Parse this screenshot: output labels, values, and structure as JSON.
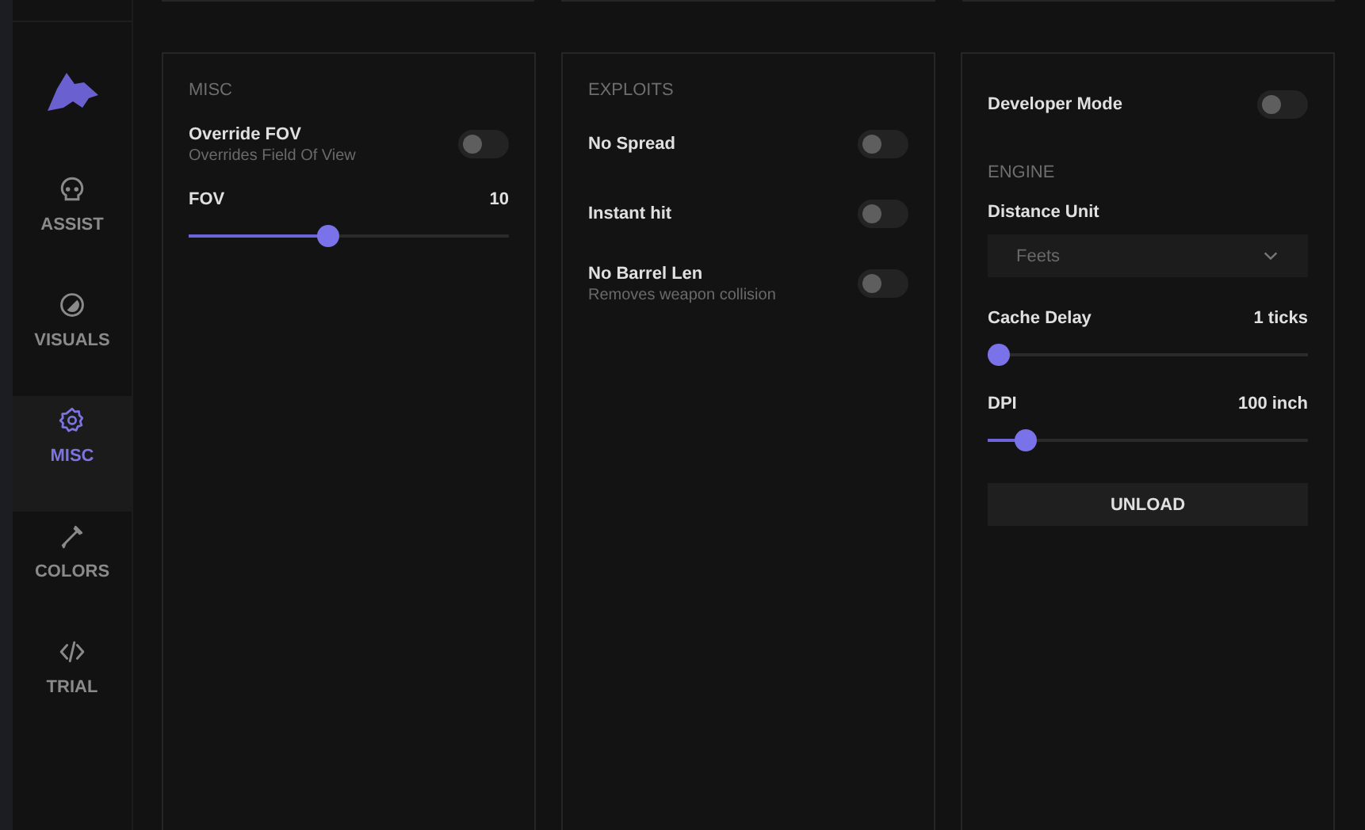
{
  "sidebar": {
    "items": [
      {
        "label": "ASSIST",
        "selected": false
      },
      {
        "label": "VISUALS",
        "selected": false
      },
      {
        "label": "MISC",
        "selected": true
      },
      {
        "label": "COLORS",
        "selected": false
      },
      {
        "label": "TRIAL",
        "selected": false
      }
    ]
  },
  "panels": [
    {
      "items": [
        {
          "kind": "heading",
          "label": "MISC"
        },
        {
          "kind": "toggle",
          "label": "Override FOV",
          "description": "Overrides Field Of View",
          "on": false
        },
        {
          "kind": "slider",
          "label": "FOV",
          "reading": "10",
          "level": 0.43
        }
      ]
    },
    {
      "items": [
        {
          "kind": "heading",
          "label": "EXPLOITS"
        },
        {
          "kind": "toggle",
          "label": "No Spread",
          "on": false
        },
        {
          "kind": "toggle",
          "label": "Instant hit",
          "on": false
        },
        {
          "kind": "toggle",
          "label": "No Barrel Len",
          "description": "Removes weapon collision",
          "on": false
        }
      ]
    },
    {
      "items": [
        {
          "kind": "toggle",
          "label": "Developer Mode",
          "on": false
        },
        {
          "kind": "heading",
          "label": "ENGINE"
        },
        {
          "kind": "select",
          "label": "Distance Unit",
          "value": "Feets"
        },
        {
          "kind": "slider",
          "label": "Cache Delay",
          "reading": "1 ticks",
          "level": 0
        },
        {
          "kind": "slider",
          "label": "DPI",
          "reading": "100 inch",
          "level": 0.09
        },
        {
          "kind": "button",
          "label": "UNLOAD"
        }
      ]
    }
  ]
}
